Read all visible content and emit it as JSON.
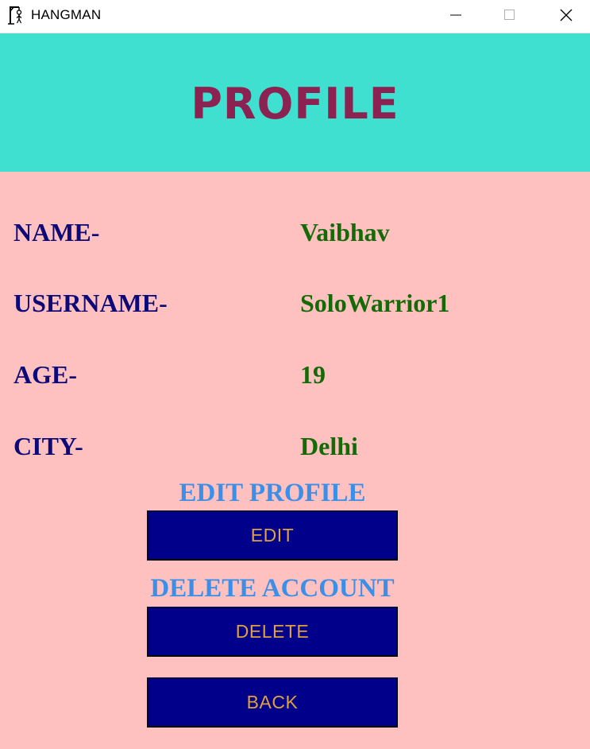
{
  "window": {
    "title": "HANGMAN",
    "app_icon": "hangman-gallows-icon",
    "controls": [
      "minimize-icon",
      "maximize-icon",
      "close-icon"
    ]
  },
  "header": {
    "title": "PROFILE"
  },
  "profile": {
    "fields": [
      {
        "label": "NAME-",
        "value": "Vaibhav"
      },
      {
        "label": "USERNAME-",
        "value": "SoloWarrior1"
      },
      {
        "label": "AGE-",
        "value": "19"
      },
      {
        "label": "CITY-",
        "value": "Delhi"
      }
    ]
  },
  "actions": {
    "edit_heading": "EDIT PROFILE",
    "edit_label": "EDIT",
    "delete_heading": "DELETE ACCOUNT",
    "delete_label": "DELETE",
    "back_label": "BACK"
  },
  "colors": {
    "header_bg": "#40e0d0",
    "header_text": "#8b2252",
    "content_bg": "#ffc0c0",
    "label_text": "#0d0a78",
    "value_text": "#156a08",
    "heading_text": "#3a8fe8",
    "button_bg": "#00008b",
    "button_text": "#e0a040"
  }
}
